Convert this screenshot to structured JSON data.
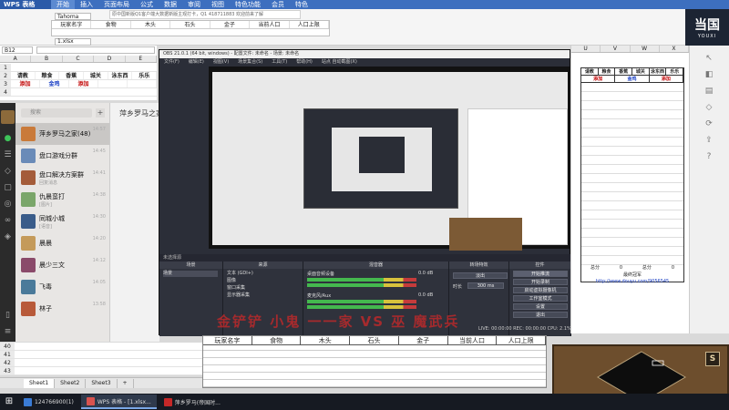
{
  "wps": {
    "app_name": "WPS 表格",
    "menu": [
      "开始",
      "插入",
      "页面布局",
      "公式",
      "数据",
      "审阅",
      "视图",
      "特色功能",
      "会员",
      "特色"
    ],
    "active_menu": "开始",
    "font_box": "Tahoma",
    "file_tab": "1.xlsx",
    "name_box": "B12",
    "banner": "原中国新版Q1客户端大数据新版主观打卡，Q1  418711883 欢迎前来了解",
    "top_headers": [
      "玩家名字",
      "食物",
      "木头",
      "石头",
      "金子",
      "当前人口",
      "人口上限"
    ]
  },
  "brand": {
    "big": "当国",
    "small": "YOUXI"
  },
  "left_sheet": {
    "columns": [
      "A",
      "B",
      "C",
      "D",
      "E"
    ],
    "header_row": [
      "请教",
      "粮食",
      "香蕉",
      "城关",
      "泳东西",
      "乐乐"
    ],
    "link_row": [
      "添加",
      "金鸡",
      "添加"
    ],
    "row_numbers": [
      "1",
      "2",
      "3",
      "4"
    ]
  },
  "chat": {
    "search_placeholder": "搜索",
    "title": "萍乡罗马之家",
    "items": [
      {
        "name": "萍乡罗马之家(48)",
        "sub": "",
        "time": "14:57",
        "color": "#c97a3a"
      },
      {
        "name": "盘口游戏分群",
        "sub": "",
        "time": "14:45",
        "color": "#6a8bb8"
      },
      {
        "name": "盘口解决方案群",
        "sub": "回复消息",
        "time": "14:41",
        "color": "#a45c3a"
      },
      {
        "name": "仇晨蛮打",
        "sub": "[图片]",
        "time": "14:38",
        "color": "#7aa66a"
      },
      {
        "name": "同城小城",
        "sub": "[语音]",
        "time": "14:30",
        "color": "#3a5c8a"
      },
      {
        "name": "晨晨",
        "sub": "",
        "time": "14:20",
        "color": "#c49a5a"
      },
      {
        "name": "晨少三文",
        "sub": "",
        "time": "14:12",
        "color": "#8a4a6a"
      },
      {
        "name": "飞毒",
        "sub": "",
        "time": "14:05",
        "color": "#4a7a9a"
      },
      {
        "name": "林子",
        "sub": "",
        "time": "13:58",
        "color": "#b85a3a"
      }
    ]
  },
  "obs": {
    "title": "OBS 21.0.1 (64 bit, windows) - 配置文件: 未命名 - 场景: 未命名",
    "menu": [
      "文件(F)",
      "编辑(E)",
      "视图(V)",
      "场景集合(S)",
      "工具(T)",
      "帮助(H)",
      "站点 自动截图(X)"
    ],
    "scenes_header": "未选择源",
    "docks": {
      "scenes": "场景",
      "sources": "来源",
      "mixer": "混音器",
      "transitions": "转场特效",
      "controls": "控件"
    },
    "scene_items": [
      "场景"
    ],
    "source_items": [
      "文本 (GDI+)",
      "图像",
      "窗口采集",
      "显示器采集"
    ],
    "mixer": {
      "desktop": "桌面音频设备",
      "mic": "麦克风/Aux",
      "db1": "0.0 dB",
      "db2": "0.0 dB"
    },
    "transition_type": "淡出",
    "duration_label": "时长",
    "duration_value": "300 ms",
    "buttons": [
      "开始推流",
      "开始录制",
      "启动虚拟摄像机",
      "工作室模式",
      "设置",
      "退出"
    ],
    "status": "LIVE: 00:00:00  REC: 00:00:00  CPU: 2.1%, 30.00 fps",
    "overlay": "金铲铲 小鬼 一一家 VS 巫 魔武兵"
  },
  "right_sheet": {
    "columns": [
      "U",
      "V",
      "W",
      "X"
    ],
    "header_row": [
      "请教",
      "粮食",
      "香蕉",
      "城关",
      "泳东西",
      "乐乐"
    ],
    "link_row": [
      "添加",
      "金鸡",
      "添加"
    ],
    "footer_row1": [
      "总分",
      "0",
      "总分",
      "0"
    ],
    "footer_row2": "最终冠军",
    "url": "http://www.douyu.com/9056545"
  },
  "bottom_table": {
    "headers": [
      "玩家名字",
      "食物",
      "木头",
      "石头",
      "金子",
      "当前人口",
      "人口上限"
    ]
  },
  "left_bottom": {
    "row_numbers": [
      "40",
      "41",
      "42",
      "43"
    ],
    "tabs": [
      "Sheet1",
      "Sheet2",
      "Sheet3"
    ],
    "active_tab": "Sheet1",
    "add_tab": "+"
  },
  "game_thumb": {
    "s_button": "S"
  },
  "taskbar": [
    {
      "label": "124766900(1)",
      "color": "#3a7bd5",
      "active": false
    },
    {
      "label": "WPS 表格 - [1.xlsx...",
      "color": "#d9534f",
      "active": true
    },
    {
      "label": "萍乡罗马(帝国时...",
      "color": "#c62828",
      "active": false
    }
  ]
}
